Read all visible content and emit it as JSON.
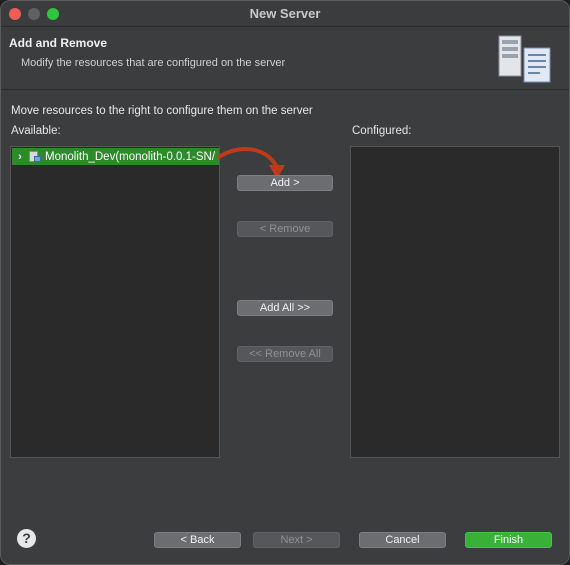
{
  "window": {
    "title": "New Server"
  },
  "banner": {
    "title": "Add and Remove",
    "subtitle": "Modify the resources that are configured on the server",
    "icon": "server-wizard-icon"
  },
  "content": {
    "instruction": "Move resources to the right to configure them on the server",
    "available_label": "Available:",
    "configured_label": "Configured:",
    "available_items": [
      {
        "label": "Monolith_Dev(monolith-0.0.1-SN/",
        "expanded": false,
        "selected": true,
        "icon": "web-project-icon"
      }
    ],
    "configured_items": []
  },
  "buttons": {
    "add": "Add >",
    "remove": "< Remove",
    "add_all": "Add All >>",
    "remove_all": "<< Remove All"
  },
  "footer": {
    "help": "?",
    "back": "< Back",
    "next": "Next >",
    "cancel": "Cancel",
    "finish": "Finish"
  },
  "colors": {
    "selection": "#2d8a2b",
    "finish": "#39b139",
    "annotation_arrow": "#c0391b"
  }
}
